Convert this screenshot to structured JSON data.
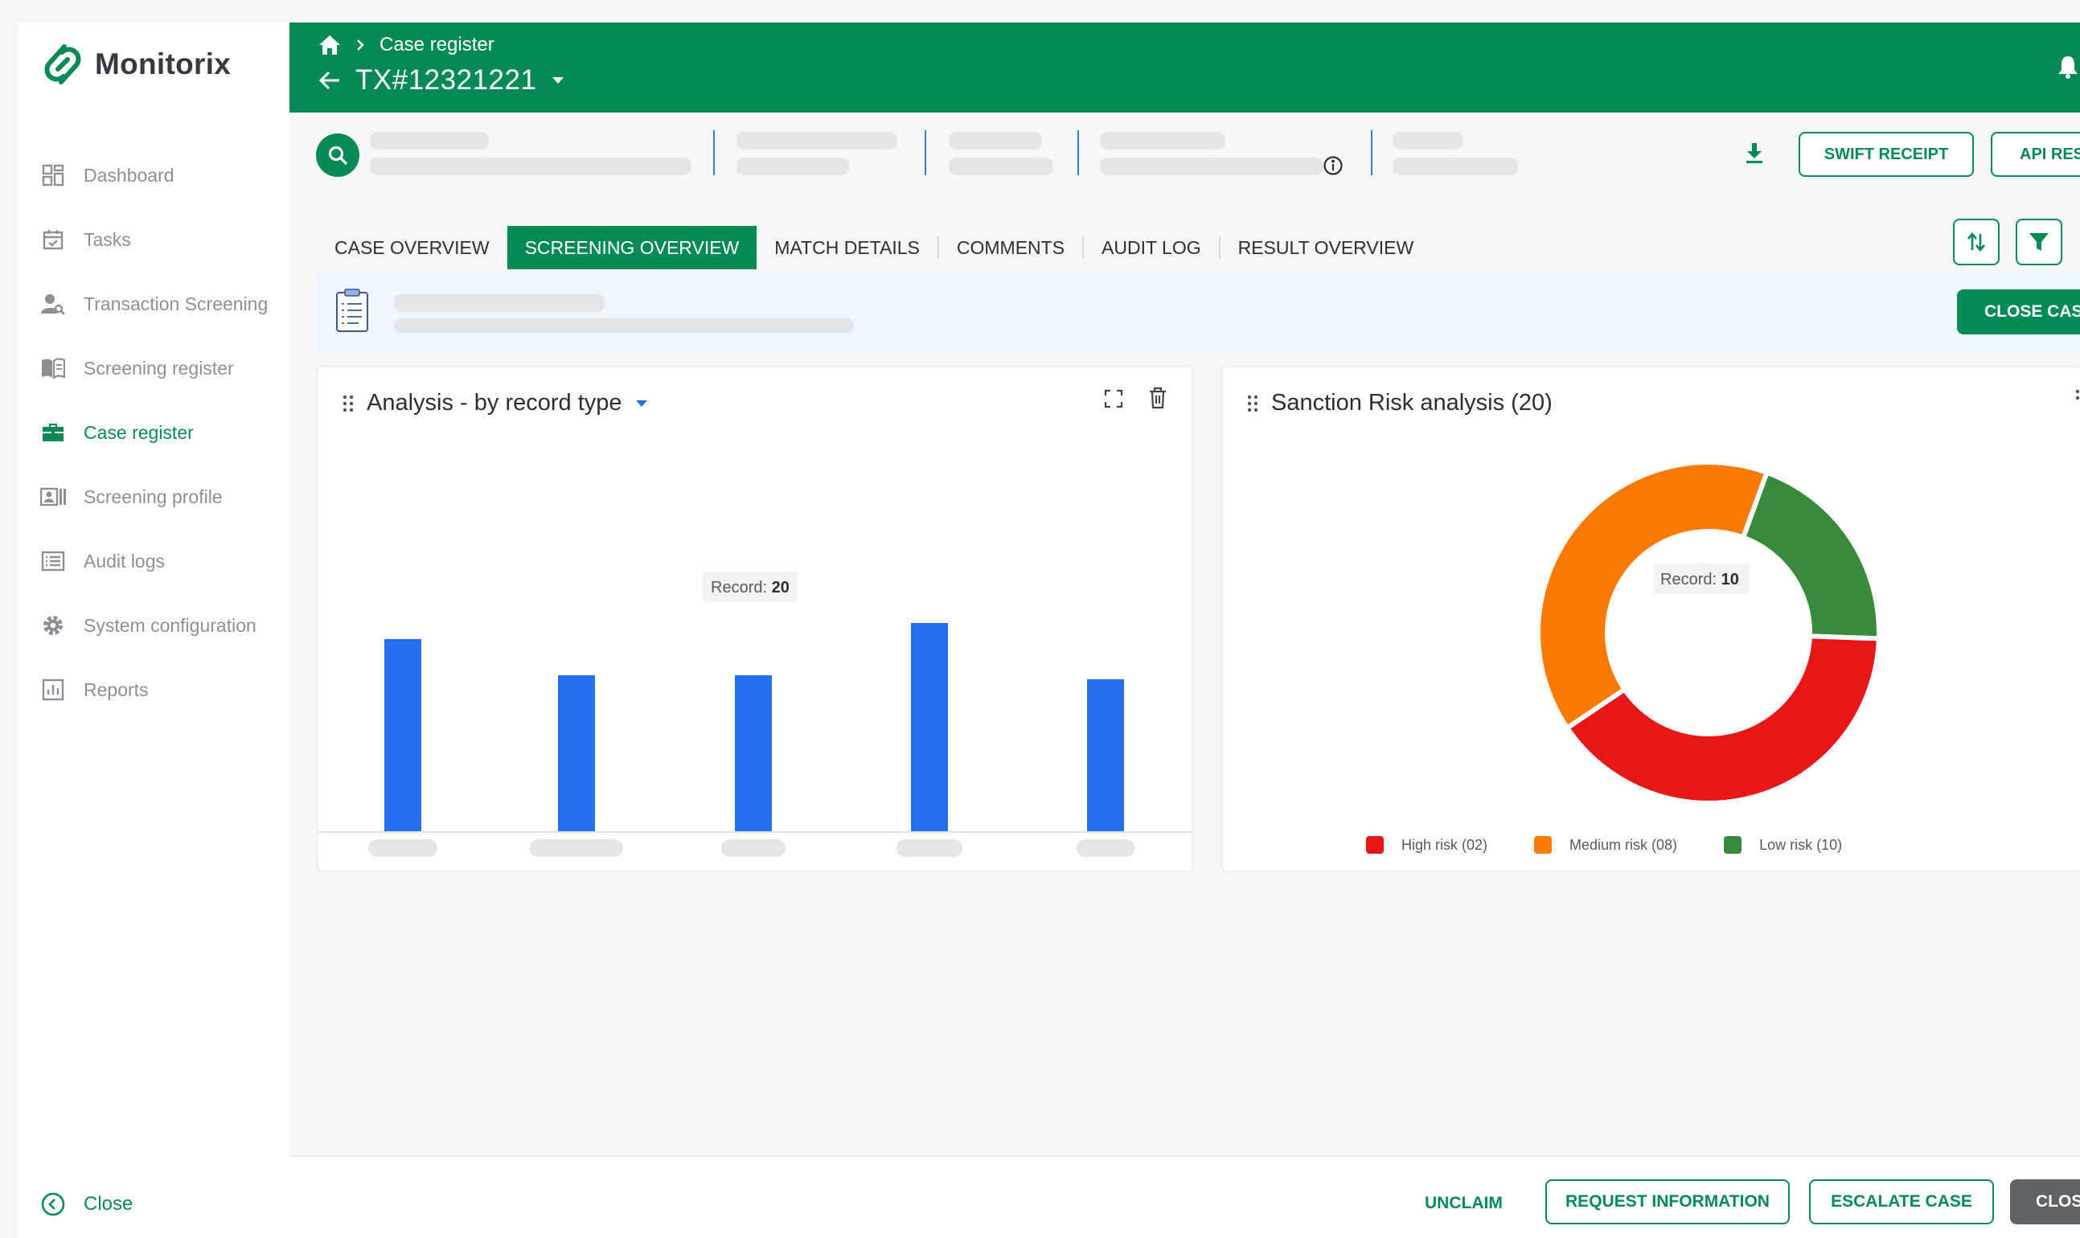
{
  "app": {
    "brand": "Monitorix"
  },
  "sidebar": {
    "items": [
      {
        "label": "Dashboard",
        "icon": "dashboard-icon",
        "active": false
      },
      {
        "label": "Tasks",
        "icon": "calendar-check-icon",
        "active": false
      },
      {
        "label": "Transaction Screening",
        "icon": "user-search-icon",
        "active": false
      },
      {
        "label": "Screening register",
        "icon": "book-icon",
        "active": false
      },
      {
        "label": "Case register",
        "icon": "briefcase-icon",
        "active": true
      },
      {
        "label": "Screening profile",
        "icon": "id-card-icon",
        "active": false
      },
      {
        "label": "Audit logs",
        "icon": "list-icon",
        "active": false
      },
      {
        "label": "System configuration",
        "icon": "gear-icon",
        "active": false
      },
      {
        "label": "Reports",
        "icon": "bar-chart-icon",
        "active": false
      }
    ],
    "close_label": "Close"
  },
  "header": {
    "breadcrumb": "Case register",
    "title": "TX#12321221"
  },
  "infobar": {
    "buttons": [
      "SWIFT RECEIPT",
      "API RES"
    ]
  },
  "tabs": [
    {
      "label": "CASE OVERVIEW",
      "active": false
    },
    {
      "label": "SCREENING OVERVIEW",
      "active": true
    },
    {
      "label": "MATCH DETAILS",
      "active": false
    },
    {
      "label": "COMMENTS",
      "active": false
    },
    {
      "label": "AUDIT LOG",
      "active": false
    },
    {
      "label": "RESULT OVERVIEW",
      "active": false
    }
  ],
  "alert": {
    "button": "CLOSE CASE"
  },
  "bar_card": {
    "title": "Analysis - by record type",
    "tooltip": {
      "label": "Record:",
      "value": "20"
    }
  },
  "pie_card": {
    "title": "Sanction Risk analysis (20)",
    "tooltip": {
      "label": "Record:",
      "value": "10"
    },
    "legend": [
      {
        "label": "High risk (02)",
        "color": "#e81717"
      },
      {
        "label": "Medium risk (08)",
        "color": "#fb7a04"
      },
      {
        "label": "Low risk (10)",
        "color": "#3a8a3d"
      }
    ]
  },
  "chart_data": [
    {
      "type": "bar",
      "title": "Analysis - by record type",
      "series": [
        {
          "values": [
            24,
            19.5,
            19.5,
            26,
            19
          ],
          "color": "#256ef0"
        }
      ],
      "ylim": [
        0,
        30
      ]
    },
    {
      "type": "pie",
      "title": "Sanction Risk analysis (20)",
      "donut": true,
      "slices": [
        {
          "label": "Low risk (10)",
          "value": 20,
          "color": "#3a8a3d"
        },
        {
          "label": "High risk (02)",
          "value": 40,
          "color": "#e81717"
        },
        {
          "label": "Medium risk (08)",
          "value": 40,
          "color": "#fb7a04"
        }
      ],
      "legend_position": "bottom"
    }
  ],
  "footer": {
    "unclaim": "UNCLAIM",
    "request_info": "REQUEST INFORMATION",
    "escalate": "ESCALATE CASE",
    "close": "CLOSE"
  }
}
